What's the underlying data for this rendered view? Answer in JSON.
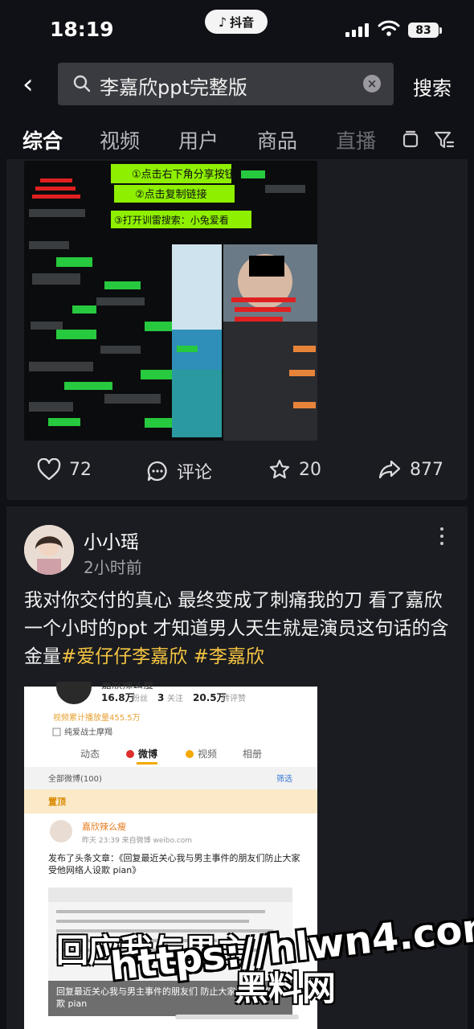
{
  "status_bar": {
    "time": "18:19",
    "app_name": "抖音",
    "battery": "83"
  },
  "search": {
    "query": "李嘉欣ppt完整版",
    "button_label": "搜索"
  },
  "tabs": [
    {
      "label": "综合",
      "active": true
    },
    {
      "label": "视频"
    },
    {
      "label": "用户"
    },
    {
      "label": "商品"
    },
    {
      "label": "直播"
    }
  ],
  "post1": {
    "image_text": {
      "step1": "①点击右下角分享按钮",
      "step2": "②点击复制链接",
      "step3": "③打开训雷搜索：小兔爱看"
    },
    "actions": {
      "likes": "72",
      "comment_label": "评论",
      "favorites": "20",
      "shares": "877"
    }
  },
  "post2": {
    "author": "小小瑶",
    "time": "2小时前",
    "text": "我对你交付的真心  最终变成了刺痛我的刀  看了嘉欣一个小时的ppt   才知道男人天生就是演员这句话的含金量",
    "hashtags": [
      "#爱仔仔李嘉欣",
      "#李嘉欣"
    ],
    "image": {
      "account": "嘉欣辣么瘦",
      "followers": "16.8万",
      "followers_label": "粉丝",
      "following": "3",
      "following_label": "关注",
      "reposts": "20.5万",
      "reposts_label": "转评赞",
      "video_views": "视频累计播放量455.5万",
      "tag": "纯爱战士摩羯",
      "tabs": [
        "动态",
        "微博",
        "视频",
        "相册"
      ],
      "all_weibo": "全部微博(100)",
      "filter": "筛选",
      "pinned": "置顶",
      "post_author": "嘉欣辣么瘦",
      "post_meta": "昨天 23:39  来自微博 weibo.com",
      "post_title": "发布了头条文章：《回复最近关心我与男主事件的朋友们防止大家受他网络人设欺 pian》",
      "quote": "回复最近关心我与男主事件的朋友们 防止大家受他网络人设欺 pian"
    },
    "watermark": {
      "line1": "回应我与男主",
      "line2": "https://hlwn4.com",
      "line3": "黑料网"
    }
  }
}
